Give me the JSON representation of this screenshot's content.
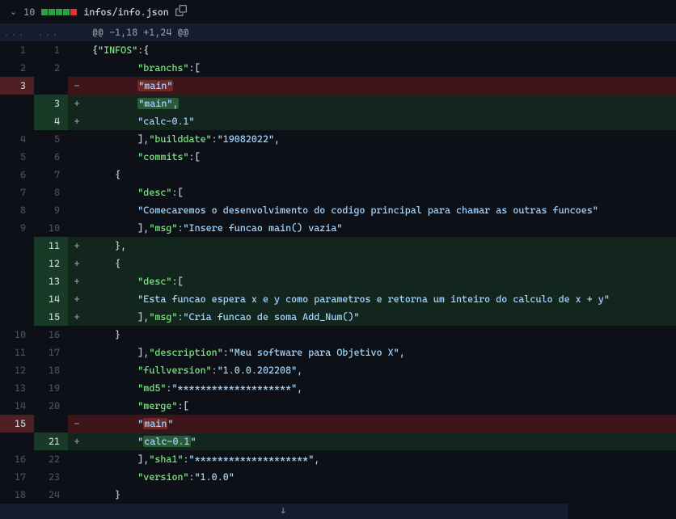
{
  "header": {
    "change_count": "10",
    "file_path": "infos/info.json"
  },
  "hunk": {
    "text": "@@ -1,18 +1,24 @@",
    "ellipsis": "..."
  },
  "rows": [
    {
      "type": "ctx",
      "old": "1",
      "new": "1",
      "code": "{<span class='tok-key'>\"INFOS\"</span>:{"
    },
    {
      "type": "ctx",
      "old": "2",
      "new": "2",
      "code": "        <span class='tok-key'>\"branchs\"</span>:["
    },
    {
      "type": "del",
      "old": "3",
      "new": "",
      "code": "        <span class='hl-del'><span class='tok-str'>\"main\"</span></span>"
    },
    {
      "type": "add",
      "old": "",
      "new": "3",
      "code": "        <span class='hl-add'><span class='tok-str'>\"main\"</span>,</span>"
    },
    {
      "type": "add",
      "old": "",
      "new": "4",
      "code": "        <span class='tok-str'>\"calc-0.1\"</span>"
    },
    {
      "type": "ctx",
      "old": "4",
      "new": "5",
      "code": "        ],<span class='tok-key'>\"builddate\"</span>:<span class='tok-str'>\"19082022\"</span>,"
    },
    {
      "type": "ctx",
      "old": "5",
      "new": "6",
      "code": "        <span class='tok-key'>\"commits\"</span>:["
    },
    {
      "type": "ctx",
      "old": "6",
      "new": "7",
      "code": "    {"
    },
    {
      "type": "ctx",
      "old": "7",
      "new": "8",
      "code": "        <span class='tok-key'>\"desc\"</span>:["
    },
    {
      "type": "ctx",
      "old": "8",
      "new": "9",
      "code": "        <span class='tok-str'>\"Comecaremos o desenvolvimento do codigo principal para chamar as outras funcoes\"</span>"
    },
    {
      "type": "ctx",
      "old": "9",
      "new": "10",
      "code": "        ],<span class='tok-key'>\"msg\"</span>:<span class='tok-str'>\"Insere funcao main() vazia\"</span>"
    },
    {
      "type": "add",
      "old": "",
      "new": "11",
      "code": "    },"
    },
    {
      "type": "add",
      "old": "",
      "new": "12",
      "code": "    {"
    },
    {
      "type": "add",
      "old": "",
      "new": "13",
      "code": "        <span class='tok-key'>\"desc\"</span>:["
    },
    {
      "type": "add",
      "old": "",
      "new": "14",
      "code": "        <span class='tok-str'>\"Esta funcao espera x e y como parametros e retorna um inteiro do calculo de x + y\"</span>"
    },
    {
      "type": "add",
      "old": "",
      "new": "15",
      "code": "        ],<span class='tok-key'>\"msg\"</span>:<span class='tok-str'>\"Cria funcao de soma Add_Num()\"</span>"
    },
    {
      "type": "ctx",
      "old": "10",
      "new": "16",
      "code": "    }"
    },
    {
      "type": "ctx",
      "old": "11",
      "new": "17",
      "code": "        ],<span class='tok-key'>\"description\"</span>:<span class='tok-str'>\"Meu software para Objetivo X\"</span>,"
    },
    {
      "type": "ctx",
      "old": "12",
      "new": "18",
      "code": "        <span class='tok-key'>\"fullversion\"</span>:<span class='tok-str'>\"1.0.0.202208\"</span>,"
    },
    {
      "type": "ctx",
      "old": "13",
      "new": "19",
      "code": "        <span class='tok-key'>\"md5\"</span>:<span class='tok-str'>\"********************\"</span>,"
    },
    {
      "type": "ctx",
      "old": "14",
      "new": "20",
      "code": "        <span class='tok-key'>\"merge\"</span>:["
    },
    {
      "type": "del",
      "old": "15",
      "new": "",
      "code": "        <span class='tok-str'>\"<span class='hl-del'>main</span>\"</span>"
    },
    {
      "type": "add",
      "old": "",
      "new": "21",
      "code": "        <span class='tok-str'>\"<span class='hl-add'>calc-0.1</span>\"</span>"
    },
    {
      "type": "ctx",
      "old": "16",
      "new": "22",
      "code": "        ],<span class='tok-key'>\"sha1\"</span>:<span class='tok-str'>\"********************\"</span>,"
    },
    {
      "type": "ctx",
      "old": "17",
      "new": "23",
      "code": "        <span class='tok-key'>\"version\"</span>:<span class='tok-str'>\"1.0.0\"</span>"
    },
    {
      "type": "ctx",
      "old": "18",
      "new": "24",
      "code": "    }"
    }
  ],
  "footer": {
    "expand": "↓"
  }
}
